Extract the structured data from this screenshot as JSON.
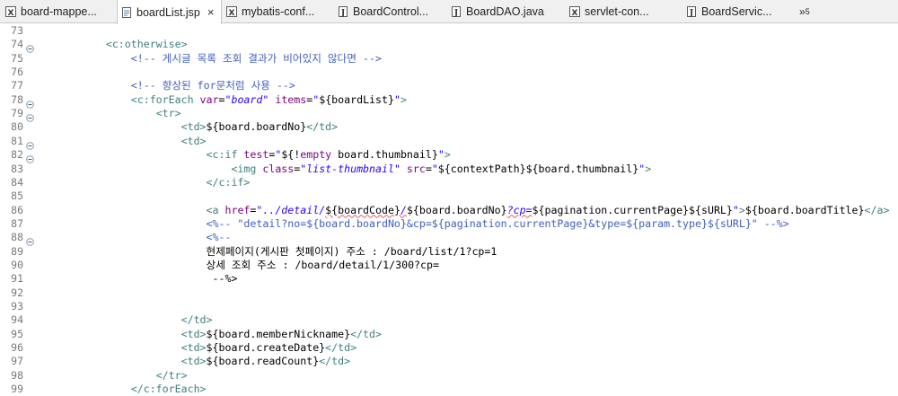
{
  "tabs": [
    {
      "label": "board-mappe...",
      "icon": "xml-file-icon",
      "active": false
    },
    {
      "label": "boardList.jsp",
      "icon": "jsp-file-icon",
      "active": true
    },
    {
      "label": "mybatis-conf...",
      "icon": "xml-file-icon",
      "active": false
    },
    {
      "label": "BoardControl...",
      "icon": "java-file-icon",
      "active": false
    },
    {
      "label": "BoardDAO.java",
      "icon": "java-file-icon",
      "active": false
    },
    {
      "label": "servlet-con...",
      "icon": "xml-file-icon",
      "active": false
    },
    {
      "label": "BoardServic...",
      "icon": "java-file-icon",
      "active": false
    }
  ],
  "close_glyph": "×",
  "overflow": {
    "glyph": "»",
    "count": "5"
  },
  "lines": [
    {
      "n": "73",
      "fold": false,
      "segs": []
    },
    {
      "n": "74",
      "fold": true,
      "segs": [
        [
          "sp",
          "        "
        ],
        [
          "tag",
          "<c:otherwise>"
        ]
      ]
    },
    {
      "n": "75",
      "fold": false,
      "segs": [
        [
          "sp",
          "            "
        ],
        [
          "comment",
          "<!-- 게시글 목록 조회 결과가 비어있지 않다면 -->"
        ]
      ]
    },
    {
      "n": "76",
      "fold": false,
      "segs": []
    },
    {
      "n": "77",
      "fold": false,
      "segs": [
        [
          "sp",
          "            "
        ],
        [
          "comment",
          "<!-- 향상된 for문처럼 사용 -->"
        ]
      ]
    },
    {
      "n": "78",
      "fold": true,
      "segs": [
        [
          "sp",
          "            "
        ],
        [
          "tag",
          "<c:forEach "
        ],
        [
          "attr",
          "var"
        ],
        [
          "el",
          "="
        ],
        [
          "str",
          "\"board\""
        ],
        [
          "el",
          " "
        ],
        [
          "attr",
          "items"
        ],
        [
          "el",
          "="
        ],
        [
          "q",
          "\""
        ],
        [
          "el",
          "${boardList}"
        ],
        [
          "q",
          "\""
        ],
        [
          "tag",
          ">"
        ]
      ]
    },
    {
      "n": "79",
      "fold": true,
      "segs": [
        [
          "sp",
          "                "
        ],
        [
          "tag",
          "<tr>"
        ]
      ]
    },
    {
      "n": "80",
      "fold": false,
      "segs": [
        [
          "sp",
          "                    "
        ],
        [
          "tag",
          "<td>"
        ],
        [
          "el",
          "${board.boardNo}"
        ],
        [
          "tag",
          "</td>"
        ]
      ]
    },
    {
      "n": "81",
      "fold": true,
      "segs": [
        [
          "sp",
          "                    "
        ],
        [
          "tag",
          "<td>"
        ]
      ]
    },
    {
      "n": "82",
      "fold": true,
      "segs": [
        [
          "sp",
          "                        "
        ],
        [
          "tag",
          "<c:if "
        ],
        [
          "attr",
          "test"
        ],
        [
          "el",
          "="
        ],
        [
          "q",
          "\""
        ],
        [
          "el",
          "${!"
        ],
        [
          "attr",
          "empty"
        ],
        [
          "el",
          " board.thumbnail}"
        ],
        [
          "q",
          "\""
        ],
        [
          "tag",
          ">"
        ]
      ]
    },
    {
      "n": "83",
      "fold": false,
      "segs": [
        [
          "sp",
          "                            "
        ],
        [
          "tag",
          "<img "
        ],
        [
          "attr",
          "class"
        ],
        [
          "el",
          "="
        ],
        [
          "str",
          "\"list-thumbnail\""
        ],
        [
          "el",
          " "
        ],
        [
          "attr",
          "src"
        ],
        [
          "el",
          "="
        ],
        [
          "q",
          "\""
        ],
        [
          "el",
          "${contextPath}${board.thumbnail}"
        ],
        [
          "q",
          "\""
        ],
        [
          "tag",
          ">"
        ]
      ]
    },
    {
      "n": "84",
      "fold": false,
      "segs": [
        [
          "sp",
          "                        "
        ],
        [
          "tag",
          "</c:if>"
        ]
      ]
    },
    {
      "n": "85",
      "fold": false,
      "segs": []
    },
    {
      "n": "86",
      "fold": false,
      "segs": [
        [
          "sp",
          "                        "
        ],
        [
          "tag",
          "<a "
        ],
        [
          "attr",
          "href"
        ],
        [
          "el",
          "="
        ],
        [
          "str",
          "\"../detail/"
        ],
        [
          "el",
          "${boardCode}"
        ],
        [
          "str",
          "/"
        ],
        [
          "el",
          "${board.boardNo}"
        ],
        [
          "cpitalic",
          "?cp="
        ],
        [
          "el",
          "${pagination.currentPage}${sURL}"
        ],
        [
          "q",
          "\""
        ],
        [
          "tag",
          ">"
        ],
        [
          "el",
          "${board.boardTitle}"
        ],
        [
          "tag",
          "</a>"
        ]
      ]
    },
    {
      "n": "87",
      "fold": false,
      "segs": [
        [
          "sp",
          "                        "
        ],
        [
          "comment",
          "<%-- \"detail?no=${board.boardNo}&cp=${pagination.currentPage}&type=${param.type}${sURL}\" --%>"
        ]
      ]
    },
    {
      "n": "88",
      "fold": true,
      "segs": [
        [
          "sp",
          "                        "
        ],
        [
          "comment",
          "<%--"
        ]
      ]
    },
    {
      "n": "89",
      "fold": false,
      "segs": [
        [
          "sp",
          "                        "
        ],
        [
          "el",
          "현제페이지(게시판 첫페이지) 주소 : /board/list/1?cp=1"
        ]
      ]
    },
    {
      "n": "90",
      "fold": false,
      "segs": [
        [
          "sp",
          "                        "
        ],
        [
          "el",
          "상세 조회 주소 : /board/detail/1/300?cp="
        ]
      ]
    },
    {
      "n": "91",
      "fold": false,
      "segs": [
        [
          "sp",
          "                         "
        ],
        [
          "el",
          "--%>"
        ]
      ]
    },
    {
      "n": "92",
      "fold": false,
      "segs": []
    },
    {
      "n": "93",
      "fold": false,
      "segs": []
    },
    {
      "n": "94",
      "fold": false,
      "segs": [
        [
          "sp",
          "                    "
        ],
        [
          "tag",
          "</td>"
        ]
      ]
    },
    {
      "n": "95",
      "fold": false,
      "segs": [
        [
          "sp",
          "                    "
        ],
        [
          "tag",
          "<td>"
        ],
        [
          "el",
          "${board.memberNickname}"
        ],
        [
          "tag",
          "</td>"
        ]
      ]
    },
    {
      "n": "96",
      "fold": false,
      "segs": [
        [
          "sp",
          "                    "
        ],
        [
          "tag",
          "<td>"
        ],
        [
          "el",
          "${board.createDate}"
        ],
        [
          "tag",
          "</td>"
        ]
      ]
    },
    {
      "n": "97",
      "fold": false,
      "segs": [
        [
          "sp",
          "                    "
        ],
        [
          "tag",
          "<td>"
        ],
        [
          "el",
          "${board.readCount}"
        ],
        [
          "tag",
          "</td>"
        ]
      ]
    },
    {
      "n": "98",
      "fold": false,
      "segs": [
        [
          "sp",
          "                "
        ],
        [
          "tag",
          "</tr>"
        ]
      ]
    },
    {
      "n": "99",
      "fold": false,
      "segs": [
        [
          "sp",
          "            "
        ],
        [
          "tag",
          "</c:forEach>"
        ]
      ]
    }
  ]
}
